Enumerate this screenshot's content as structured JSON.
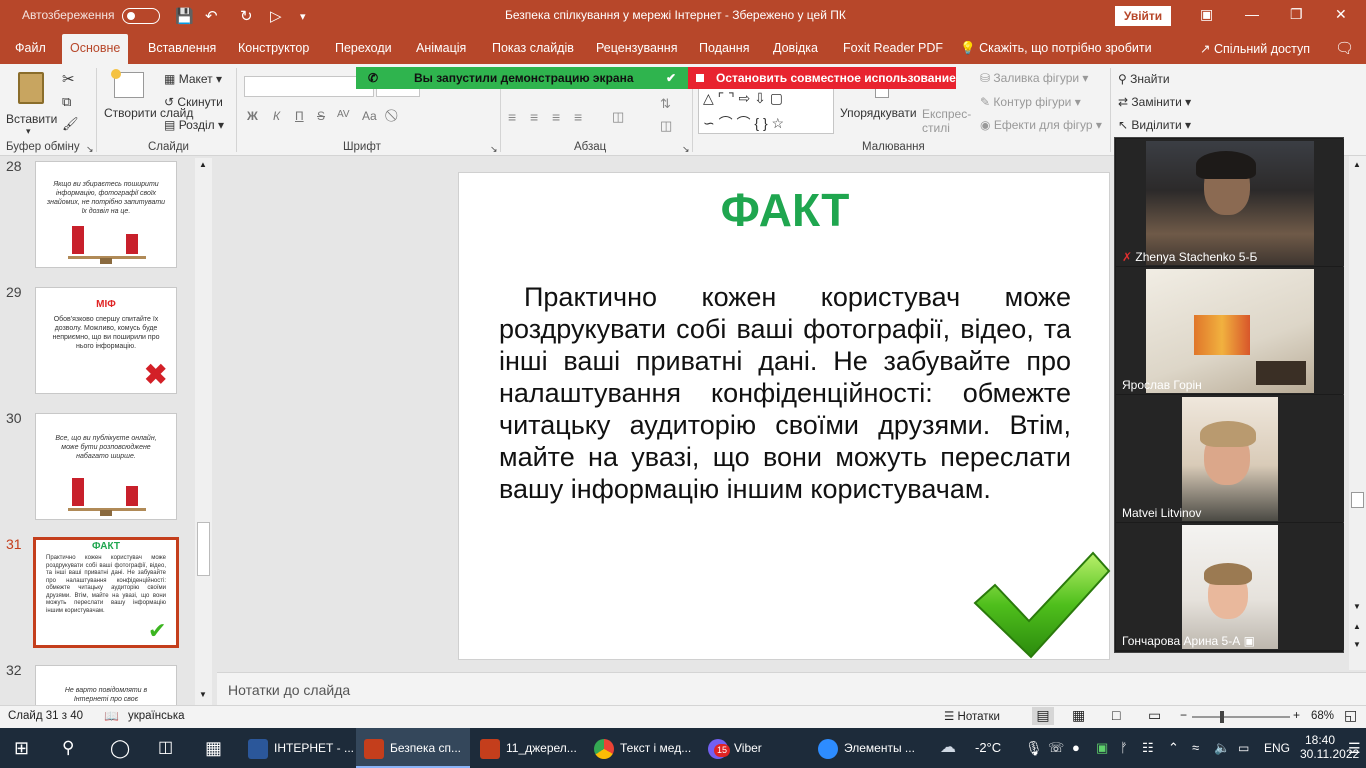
{
  "titlebar": {
    "autosave_label": "Автозбереження",
    "title": "Безпека спілкування у мережі Інтернет  -  Збережено у цей ПК",
    "signin_label": "Увійти"
  },
  "tabs": [
    "Файл",
    "Основне",
    "Вставлення",
    "Конструктор",
    "Переходи",
    "Анімація",
    "Показ слайдів",
    "Рецензування",
    "Подання",
    "Довідка",
    "Foxit Reader PDF"
  ],
  "tellme": "Скажіть, що потрібно зробити",
  "share_label": "Спільний доступ",
  "ribbon": {
    "paste": "Вставити",
    "clipboard_group": "Буфер обміну",
    "new_slide": "Створити слайд",
    "layout": "Макет",
    "reset": "Скинути",
    "section": "Розділ",
    "slides_group": "Слайди",
    "font_group": "Шрифт",
    "paragraph_group": "Абзац",
    "arrange": "Упорядкувати",
    "quick_styles": "Експрес-стилі",
    "shape_fill": "Заливка фігури",
    "shape_outline": "Контур фігури",
    "shape_effects": "Ефекти для фігур",
    "drawing_group": "Малювання",
    "find": "Знайти",
    "replace": "Замінити",
    "select": "Виділити",
    "bold": "Ж",
    "italic": "К",
    "underline": "П",
    "strike": "S",
    "spacing": "AV",
    "case": "Aa"
  },
  "screenshare": {
    "notice": "Вы запустили демонстрацию экрана",
    "stop": "Остановить совместное использование"
  },
  "thumbnails": [
    {
      "number": "28",
      "text": "Якщо ви збираєтесь поширити інформацію, фотографії своїх знайомих, не потрібно запитувати їх дозвіл на це."
    },
    {
      "number": "29",
      "title": "МІФ",
      "text": "Обов'язково спершу спитайте їх дозволу. Можливо, комусь буде неприємно, що ви поширили про нього інформацію."
    },
    {
      "number": "30",
      "text": "Все, що ви публікуєте онлайн, може бути розповсюджене набагато ширше."
    },
    {
      "number": "31",
      "title": "ФАКТ",
      "text": "Практично кожен користувач може роздрукувати собі ваші фотографії, відео, та інші ваші приватні дані. Не забувайте про налаштування конфіденційності: обмежте читацьку аудиторію своїми друзями. Втім, майте на увазі, що вони можуть переслати вашу інформацію іншим користувачам."
    },
    {
      "number": "32",
      "text": "Не варто повідомляти в Інтернеті про своє"
    }
  ],
  "slide": {
    "title": "ФАКТ",
    "body": "Практично кожен користувач може роздрукувати собі ваші фотографії, відео, та інші ваші приватні дані. Не забувайте про налаштування конфіденційності: обмежте читацьку аудиторію своїми друзями. Втім, майте на увазі, що вони можуть переслати вашу інформацію іншим користувачам."
  },
  "notes_placeholder": "Нотатки до слайда",
  "status": {
    "slide_info": "Слайд 31 з 40",
    "language": "українська",
    "notes_label": "Нотатки",
    "zoom": "68%"
  },
  "participants": [
    {
      "name": "Zhenya Stachenko 5-Б",
      "muted": true
    },
    {
      "name": "Ярослав Горін"
    },
    {
      "name": "Matvei Litvinov"
    },
    {
      "name": "Гончарова Арина 5-А"
    }
  ],
  "taskbar": {
    "items": [
      {
        "label": "ІНТЕРНЕТ - ...",
        "icon": "word-icon",
        "color": "#2b579a"
      },
      {
        "label": "Безпека сп...",
        "icon": "powerpoint-icon",
        "color": "#c43e1c"
      },
      {
        "label": "11_джерел...",
        "icon": "powerpoint-icon",
        "color": "#c43e1c"
      },
      {
        "label": "Текст і мед...",
        "icon": "chrome-icon",
        "color": "#4285f4"
      },
      {
        "label": "Viber",
        "icon": "viber-icon",
        "color": "#7360f2",
        "badge": "15"
      },
      {
        "label": "Элементы ...",
        "icon": "zoom-icon",
        "color": "#2d8cff"
      }
    ],
    "weather": "-2°C",
    "language": "ENG",
    "time": "18:40",
    "date": "30.11.2022"
  }
}
